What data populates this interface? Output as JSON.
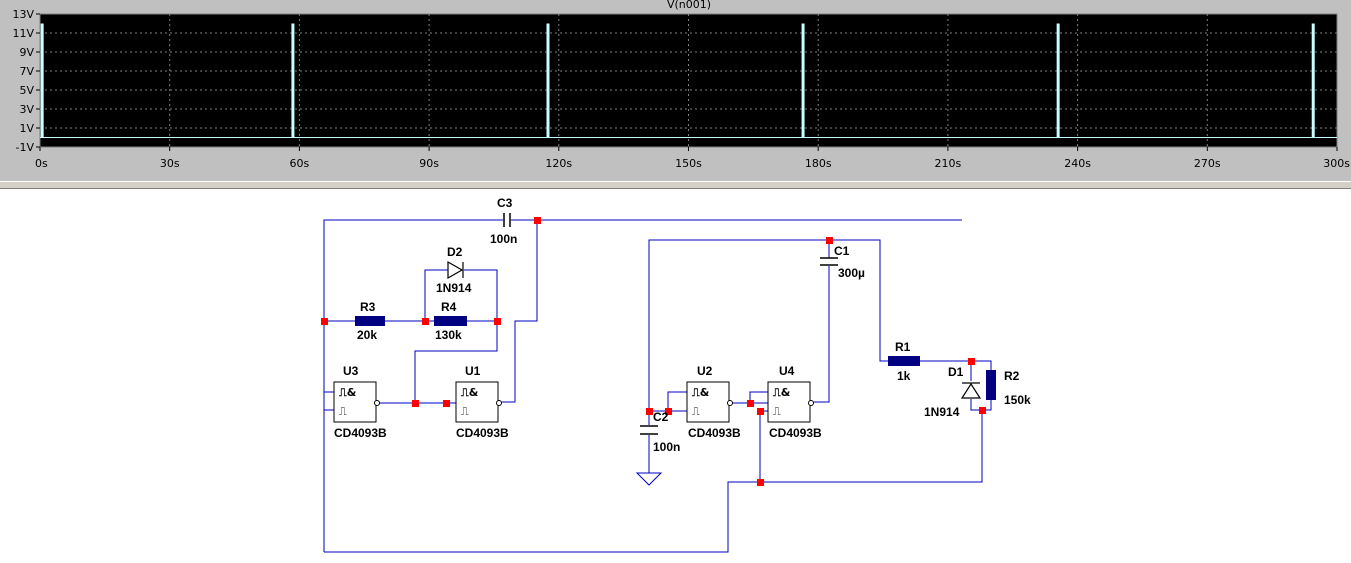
{
  "plot": {
    "trace_title": "V(n001)",
    "background": "#000000",
    "trace_color": "#c8ffff",
    "grid_color": "#808080",
    "y_ticks": [
      "13V",
      "11V",
      "9V",
      "7V",
      "5V",
      "3V",
      "1V",
      "-1V"
    ],
    "x_ticks": [
      "0s",
      "30s",
      "60s",
      "90s",
      "120s",
      "150s",
      "180s",
      "210s",
      "240s",
      "270s",
      "300s"
    ]
  },
  "chart_data": {
    "type": "line",
    "title": "V(n001)",
    "xlabel": "",
    "ylabel": "",
    "xlim": [
      0,
      300
    ],
    "ylim": [
      -1,
      13
    ],
    "grid": true,
    "series": [
      {
        "name": "V(n001)",
        "pulses_x": [
          0.5,
          58.5,
          117.5,
          176.5,
          235.5,
          294.5
        ],
        "pulse_low": 0,
        "pulse_high": 12
      }
    ]
  },
  "schematic": {
    "wire_color": "#0000c0",
    "node_color": "#ff0000",
    "part_color": "#000080",
    "components": {
      "C3": {
        "ref": "C3",
        "value": "100n"
      },
      "D2": {
        "ref": "D2",
        "value": "1N914"
      },
      "R3": {
        "ref": "R3",
        "value": "20k"
      },
      "R4": {
        "ref": "R4",
        "value": "130k"
      },
      "U3": {
        "ref": "U3",
        "value": "CD4093B"
      },
      "U1": {
        "ref": "U1",
        "value": "CD4093B"
      },
      "C1": {
        "ref": "C1",
        "value": "300µ"
      },
      "U2": {
        "ref": "U2",
        "value": "CD4093B"
      },
      "U4": {
        "ref": "U4",
        "value": "CD4093B"
      },
      "C2": {
        "ref": "C2",
        "value": "100n"
      },
      "R1": {
        "ref": "R1",
        "value": "1k"
      },
      "D1": {
        "ref": "D1",
        "value": "1N914"
      },
      "R2": {
        "ref": "R2",
        "value": "150k"
      }
    }
  }
}
